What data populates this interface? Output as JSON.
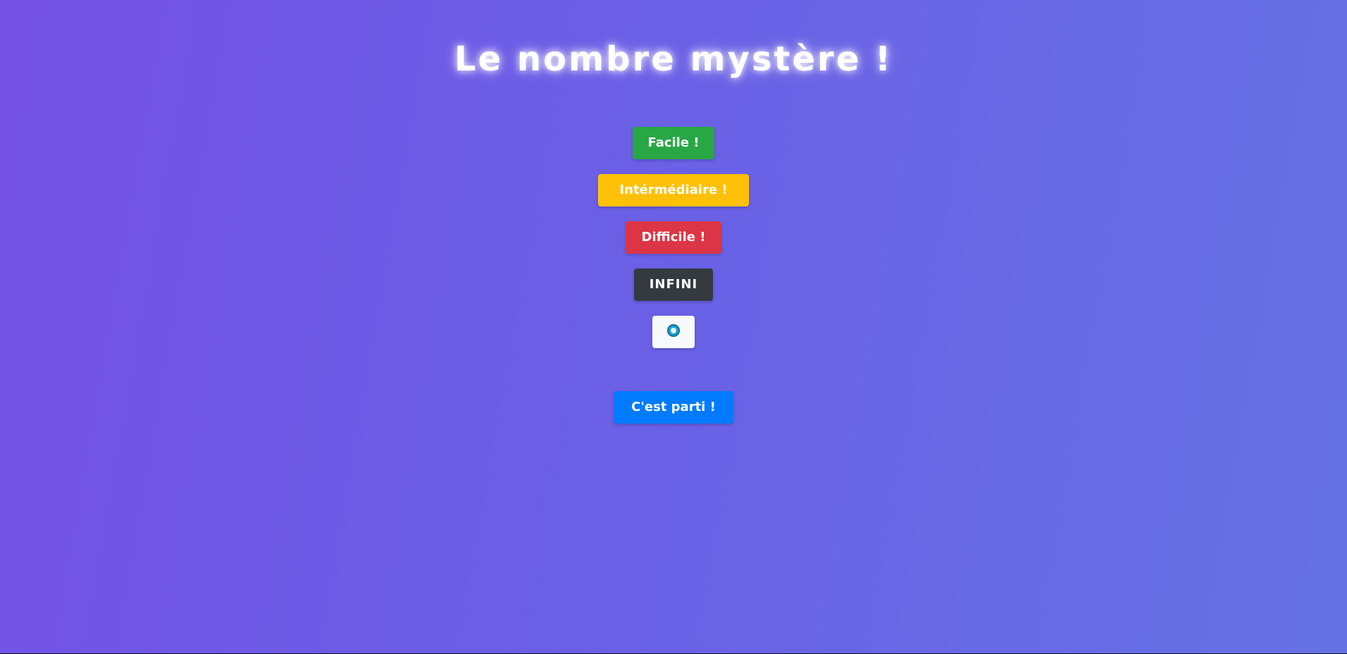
{
  "title": "Le nombre mystère !",
  "difficulty": {
    "easy_label": "Facile !",
    "intermediate_label": "Intérmédiaire !",
    "hard_label": "Difficile !",
    "infinite_label": "INFINI"
  },
  "timer_button": {
    "icon": "clock-icon"
  },
  "start_label": "C'est parti !",
  "colors": {
    "background_start": "#7452e6",
    "background_end": "#6672e4",
    "easy": "#28a745",
    "intermediate": "#ffc107",
    "hard": "#dc3545",
    "infinite": "#343a40",
    "timer": "#f8f9fa",
    "start": "#007bff"
  }
}
